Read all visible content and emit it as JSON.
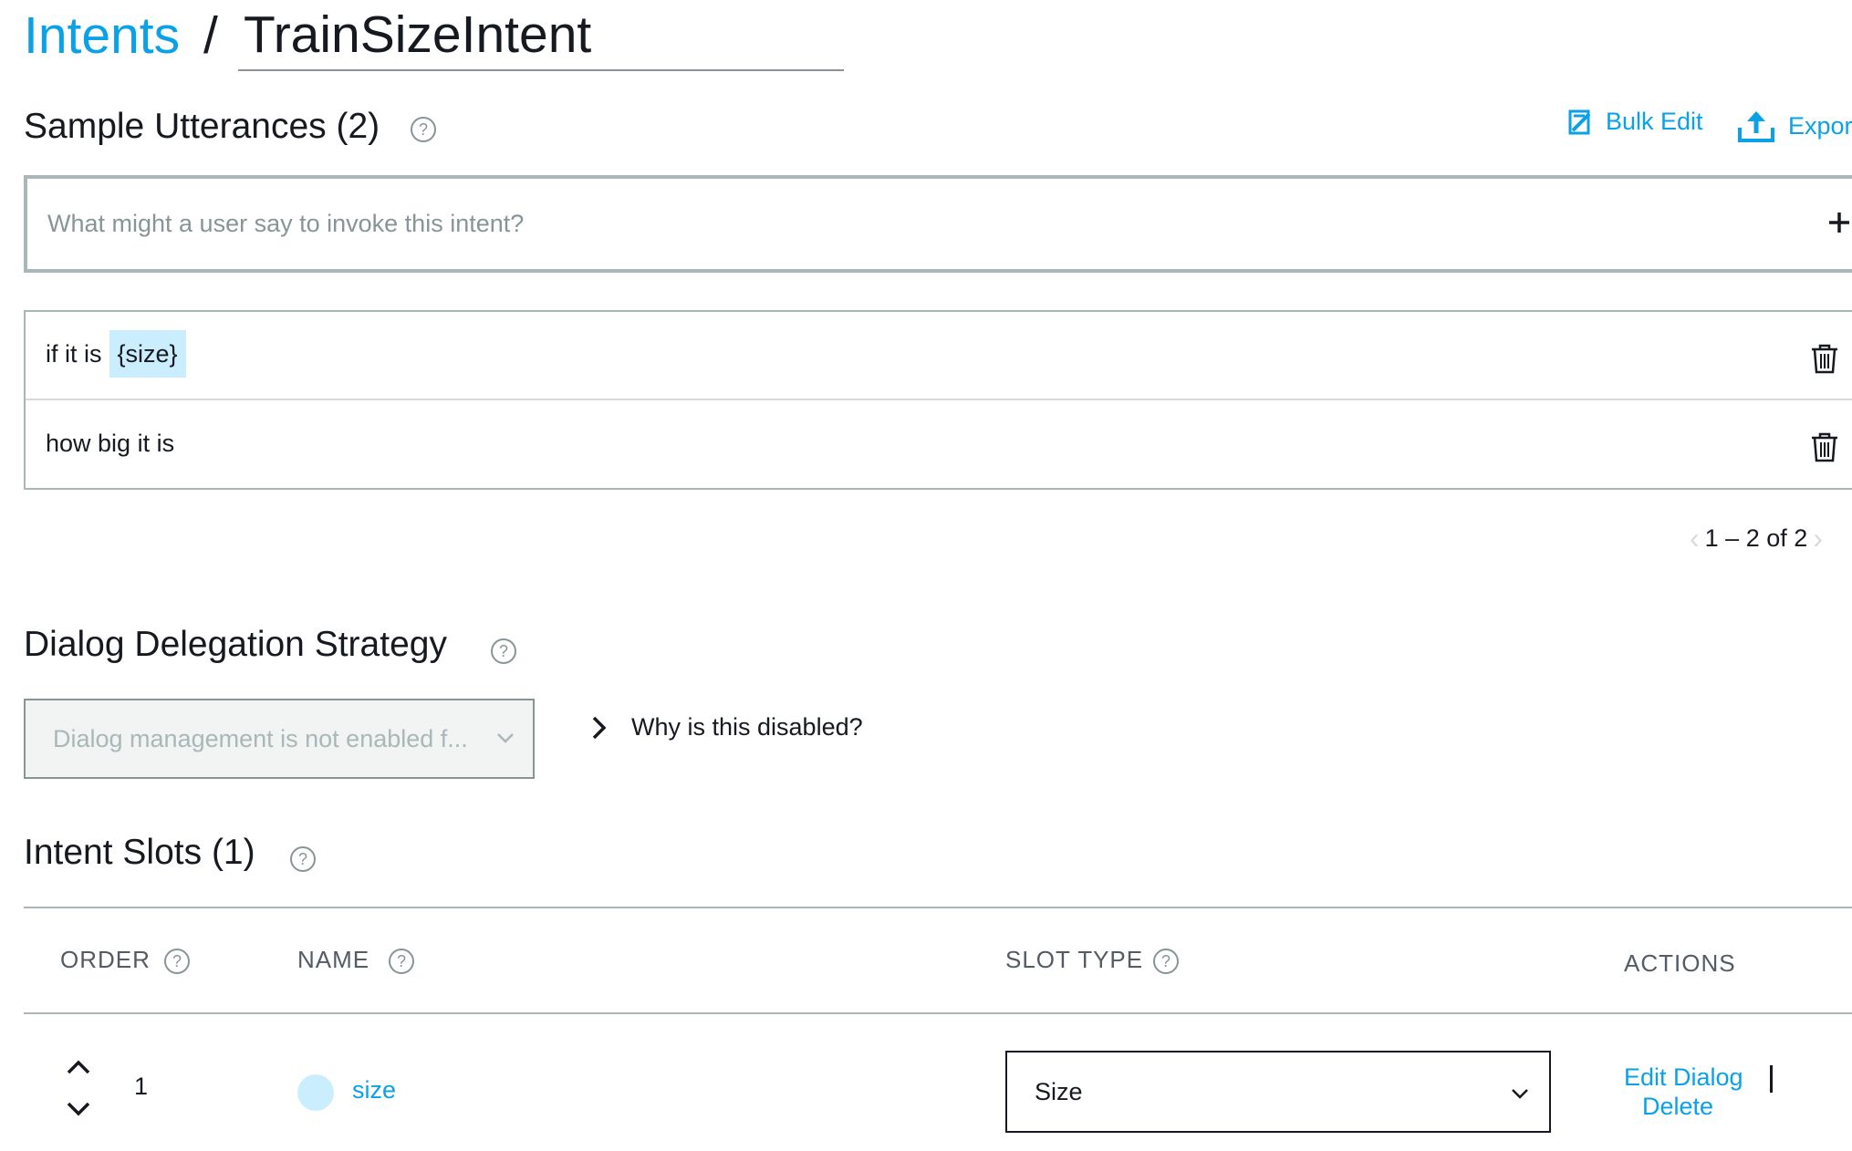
{
  "breadcrumb": {
    "parent": "Intents",
    "separator": "/",
    "intent_name": "TrainSizeIntent"
  },
  "utterances": {
    "title": "Sample Utterances (2)",
    "help_icon": "question-circle-icon",
    "bulk_edit_label": "Bulk Edit",
    "export_label": "Export",
    "input_placeholder": "What might a user say to invoke this intent?",
    "add_icon": "plus-icon",
    "items": [
      {
        "prefix": "if it is",
        "slot": "{size}"
      },
      {
        "prefix": "how big it is",
        "slot": ""
      }
    ],
    "pagination": "1 – 2 of 2"
  },
  "dialog": {
    "title": "Dialog Delegation Strategy",
    "select_value": "Dialog management is not enabled f...",
    "why_label": "Why is this disabled?"
  },
  "slots": {
    "title": "Intent Slots (1)",
    "columns": {
      "order": "ORDER",
      "name": "NAME",
      "slot_type": "SLOT TYPE",
      "actions": "ACTIONS"
    },
    "rows": [
      {
        "order": "1",
        "name": "size",
        "slot_type": "Size",
        "edit_label": "Edit Dialog",
        "delete_label": "Delete"
      }
    ]
  },
  "colors": {
    "accent": "#0aa1e6",
    "slot_highlight": "#cbeefe",
    "border": "#aab7b8",
    "text": "#16191f",
    "muted": "#879596"
  }
}
